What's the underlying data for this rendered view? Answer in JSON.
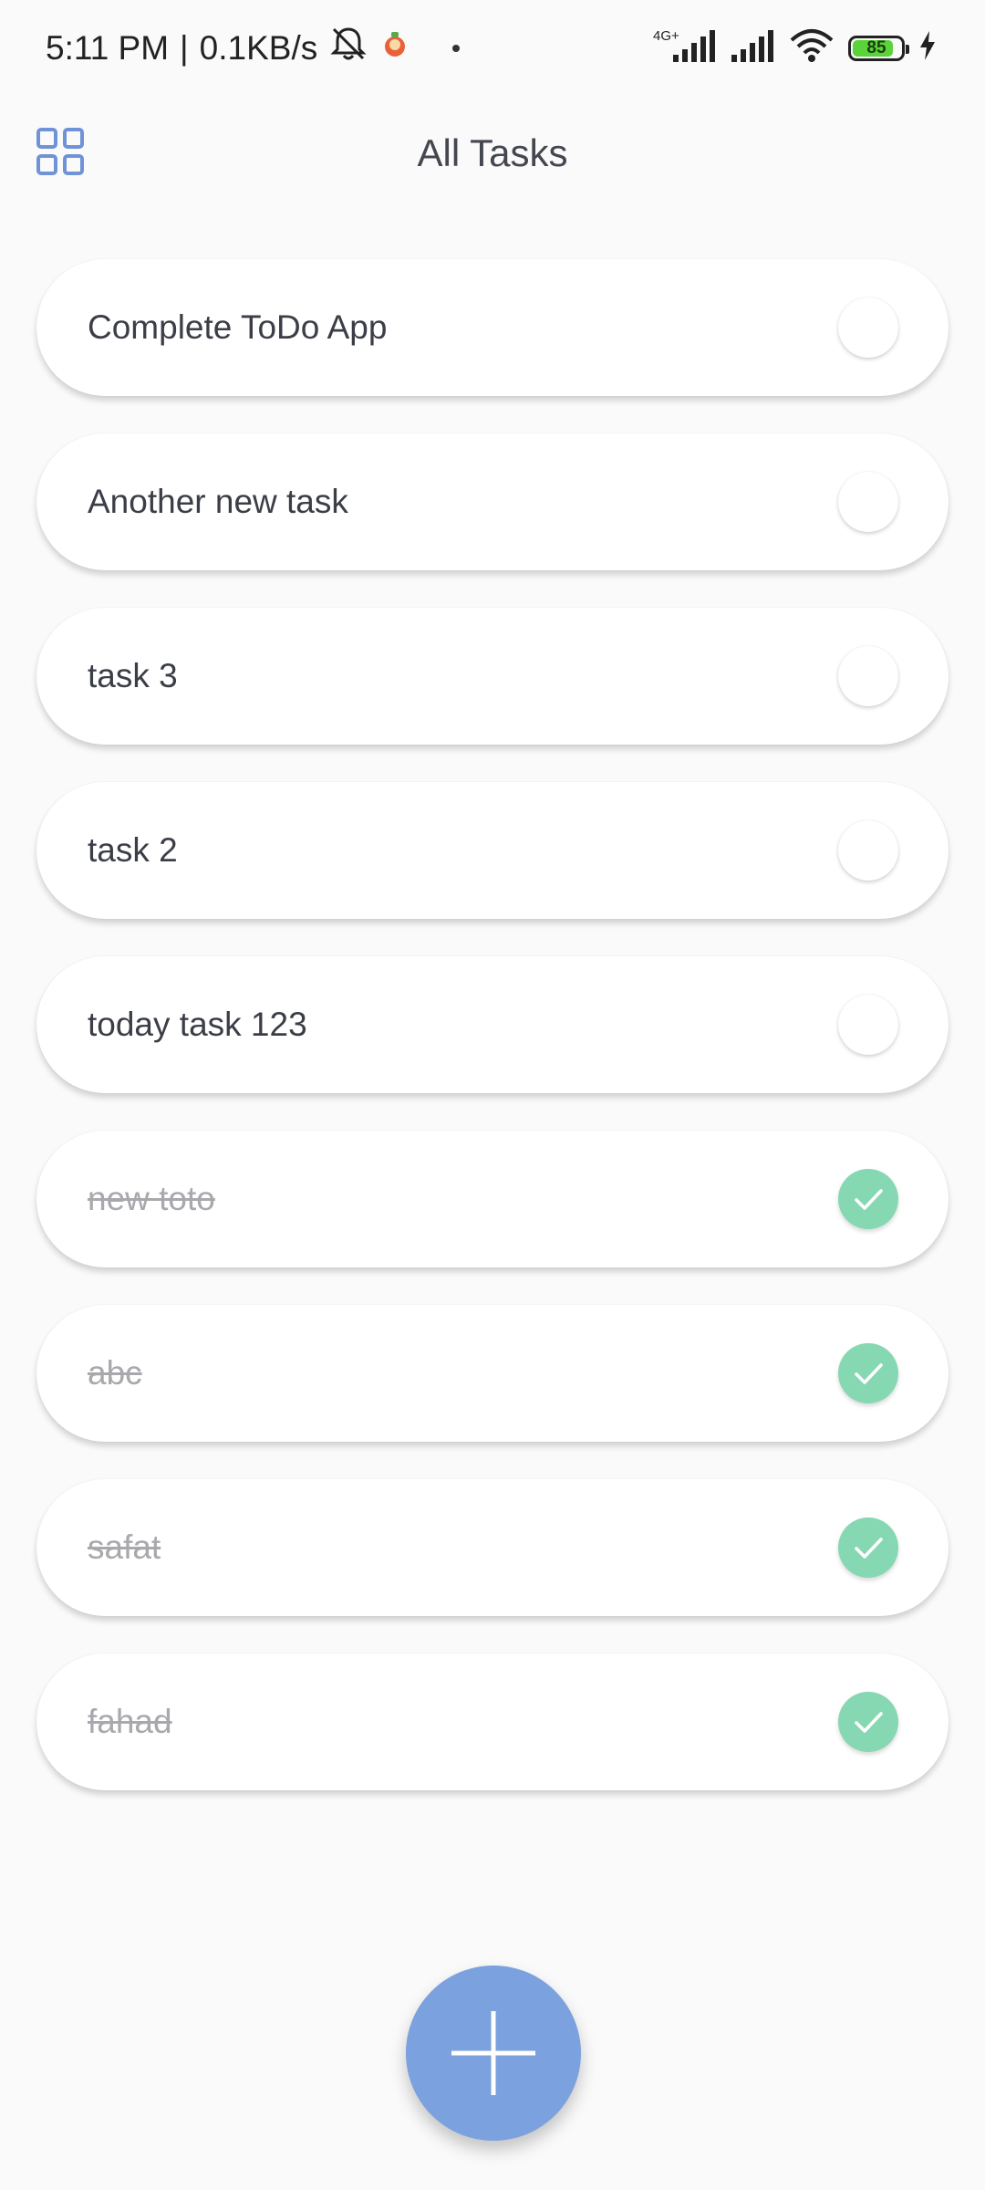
{
  "status_bar": {
    "time": "5:11 PM",
    "network_speed": "0.1KB/s",
    "battery_level": "85",
    "battery_charging": true,
    "network_type": "4G+",
    "icons": [
      "mute-bell-icon",
      "app-notification-icon",
      "signal-4g-icon",
      "signal-icon",
      "wifi-icon",
      "battery-icon",
      "charging-bolt-icon"
    ]
  },
  "header": {
    "title": "All Tasks",
    "menu_icon": "grid-icon"
  },
  "tasks": [
    {
      "label": "Complete ToDo App",
      "done": false
    },
    {
      "label": "Another new task",
      "done": false
    },
    {
      "label": "task 3",
      "done": false
    },
    {
      "label": "task 2",
      "done": false
    },
    {
      "label": "today task 123",
      "done": false
    },
    {
      "label": "new toto",
      "done": true
    },
    {
      "label": "abc",
      "done": true
    },
    {
      "label": "safat",
      "done": true
    },
    {
      "label": "fahad",
      "done": true
    }
  ],
  "fab": {
    "icon": "plus-icon"
  },
  "colors": {
    "accent": "#7ba1df",
    "done_check": "#86d8b2",
    "grid_icon": "#6f93d6"
  }
}
